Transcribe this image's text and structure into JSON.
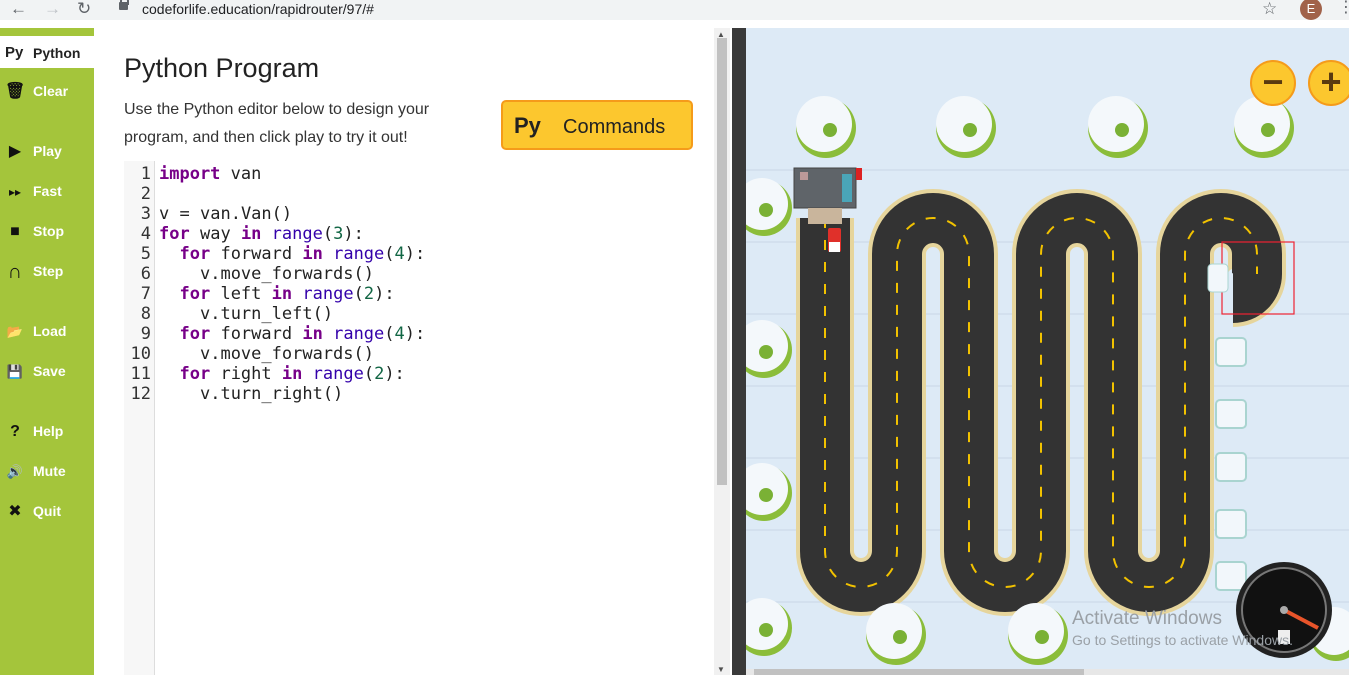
{
  "browser": {
    "back_icon": "←",
    "forward_icon": "→",
    "reload_icon": "↻",
    "url": "codeforlife.education/rapidrouter/97/#",
    "star_icon": "☆",
    "avatar_letter": "E",
    "menu_icon": "⋮"
  },
  "sidebar": {
    "python_tab": {
      "badge": "Py",
      "label": "Python"
    },
    "buttons": [
      {
        "icon": "🗑",
        "label": "Clear"
      },
      {
        "icon": "▶",
        "label": "Play"
      },
      {
        "icon": "▸▸",
        "label": "Fast"
      },
      {
        "icon": "■",
        "label": "Stop"
      },
      {
        "icon": "∩",
        "label": "Step"
      },
      {
        "icon": "📂",
        "label": "Load"
      },
      {
        "icon": "💾",
        "label": "Save"
      },
      {
        "icon": "?",
        "label": "Help"
      },
      {
        "icon": "🔊",
        "label": "Mute"
      },
      {
        "icon": "✖",
        "label": "Quit"
      }
    ]
  },
  "panel": {
    "title": "Python Program",
    "description": "Use the Python editor below to design your program, and then click play to try it out!",
    "commands_button": {
      "badge": "Py",
      "label": "Commands"
    }
  },
  "editor": {
    "line_numbers": [
      "1",
      "2",
      "3",
      "4",
      "5",
      "6",
      "7",
      "8",
      "9",
      "10",
      "11",
      "12"
    ],
    "lines": [
      "import van",
      "",
      "v = van.Van()",
      "for way in range(3):",
      "  for forward in range(4):",
      "    v.move_forwards()",
      "  for left in range(2):",
      "    v.turn_left()",
      "  for forward in range(4):",
      "    v.move_forwards()",
      "  for right in range(2):",
      "    v.turn_right()"
    ]
  },
  "game": {
    "zoom_out": "−",
    "zoom_in": "+",
    "watermark_title": "Activate Windows",
    "watermark_sub": "Go to Settings to activate Windows."
  },
  "colors": {
    "sidebar": "#a4c53b",
    "commands_fill": "#fcc72e",
    "commands_border": "#f59b1a",
    "road": "#333333",
    "road_edge": "#e6d59c",
    "lane_mark": "#f2c200",
    "game_bg": "#ddeaf6"
  }
}
